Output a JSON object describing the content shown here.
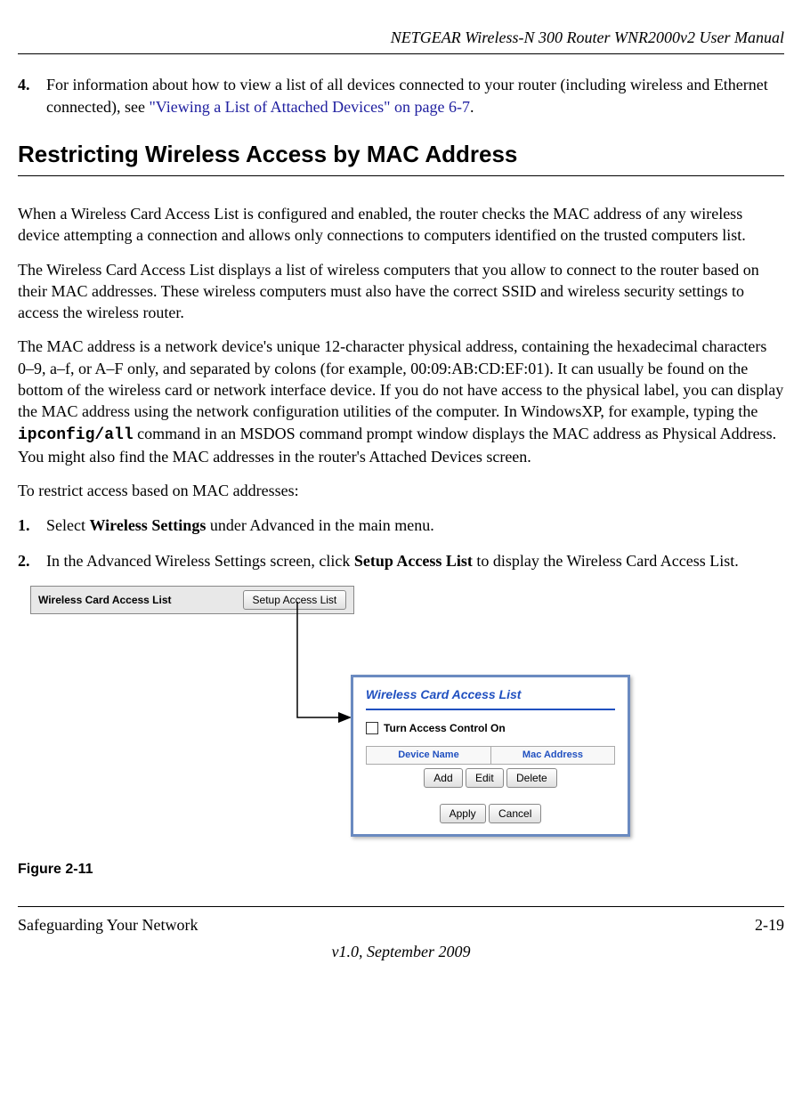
{
  "header": {
    "title": "NETGEAR Wireless-N 300 Router WNR2000v2 User Manual"
  },
  "item4": {
    "number": "4.",
    "text_before_link": "For information about how to view a list of all devices connected to your router (including wireless and Ethernet connected), see ",
    "link_text": "\"Viewing a List of Attached Devices\" on page 6-7",
    "text_after_link": "."
  },
  "section_heading": "Restricting Wireless Access by MAC Address",
  "para1": "When a Wireless Card Access List is configured and enabled, the router checks the MAC address of any wireless device attempting a connection and allows only connections to computers identified on the trusted computers list.",
  "para2": "The Wireless Card Access List displays a list of wireless computers that you allow to connect to the router based on their MAC addresses. These wireless computers must also have the correct SSID and wireless security settings to access the wireless router.",
  "para3_before": "The MAC address is a network device's unique 12-character physical address, containing the hexadecimal characters 0–9, a–f, or A–F only, and separated by colons (for example, 00:09:AB:CD:EF:01). It can usually be found on the bottom of the wireless card or network interface device. If you do not have access to the physical label, you can display the MAC address using the network configuration utilities of the computer. In WindowsXP, for example, typing the ",
  "para3_cmd": "ipconfig/all",
  "para3_after": " command in an MSDOS command prompt window displays the MAC address as Physical Address. You might also find the MAC addresses in the router's Attached Devices screen.",
  "para4": "To restrict access based on MAC addresses:",
  "step1": {
    "number": "1.",
    "before_bold": "Select ",
    "bold": "Wireless Settings",
    "after_bold": " under Advanced in the main menu."
  },
  "step2": {
    "number": "2.",
    "before_bold": "In the Advanced Wireless Settings screen, click ",
    "bold": "Setup Access List",
    "after_bold": " to display the Wireless Card Access List."
  },
  "figure": {
    "row_label": "Wireless Card Access List",
    "setup_button": "Setup Access List",
    "dialog_title": "Wireless Card Access List",
    "checkbox_label": "Turn Access Control On",
    "col_device": "Device Name",
    "col_mac": "Mac Address",
    "btn_add": "Add",
    "btn_edit": "Edit",
    "btn_delete": "Delete",
    "btn_apply": "Apply",
    "btn_cancel": "Cancel",
    "caption": "Figure 2-11"
  },
  "footer": {
    "left": "Safeguarding Your Network",
    "right": "2-19",
    "center": "v1.0, September 2009"
  }
}
